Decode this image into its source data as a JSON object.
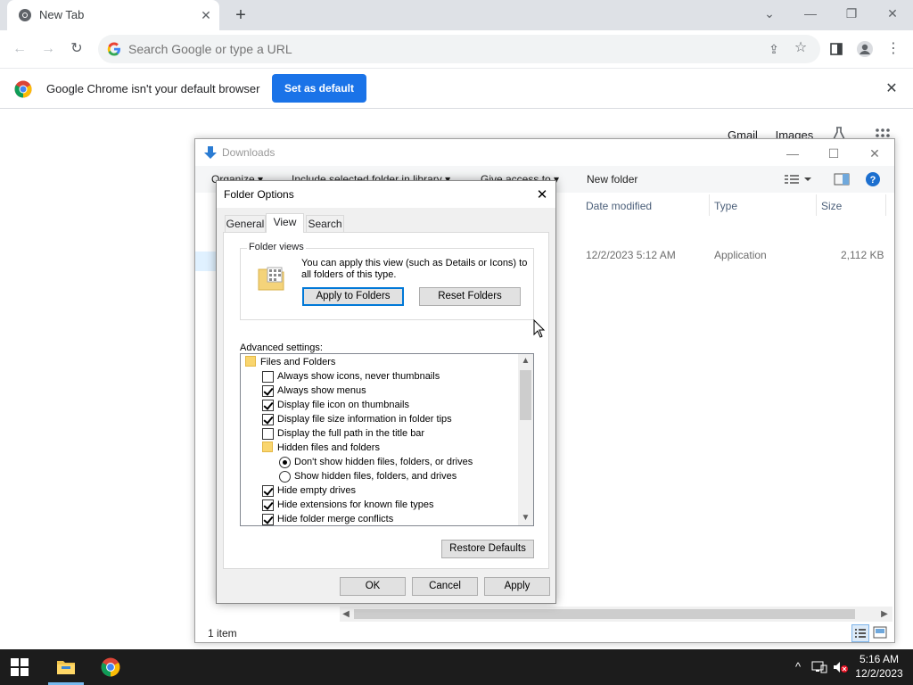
{
  "chrome": {
    "tab_title": "New Tab",
    "tab_close": "✕",
    "new_tab_label": "+",
    "omnibox_placeholder": "Search Google or type a URL",
    "infobar": {
      "message": "Google Chrome isn't your default browser",
      "button": "Set as default"
    },
    "ntp_links": [
      "Gmail",
      "Images"
    ]
  },
  "explorer": {
    "title": "Downloads",
    "commands": [
      "Organize ▾",
      "Include selected folder in library ▾",
      "Give access to ▾",
      "New folder"
    ],
    "columns": [
      "Date modified",
      "Type",
      "Size"
    ],
    "row": {
      "date": "12/2/2023 5:12 AM",
      "type": "Application",
      "size": "2,112 KB"
    },
    "status": "1 item"
  },
  "dialog": {
    "title": "Folder Options",
    "tabs": [
      "General",
      "View",
      "Search"
    ],
    "active_tab": "View",
    "folder_views": {
      "legend": "Folder views",
      "description": "You can apply this view (such as Details or Icons) to all folders of this type.",
      "apply_button": "Apply to Folders",
      "reset_button": "Reset Folders"
    },
    "advanced_label": "Advanced settings:",
    "advanced": [
      {
        "kind": "folder",
        "indent": 0,
        "label": "Files and Folders"
      },
      {
        "kind": "checkbox",
        "indent": 1,
        "checked": false,
        "label": "Always show icons, never thumbnails"
      },
      {
        "kind": "checkbox",
        "indent": 1,
        "checked": true,
        "label": "Always show menus"
      },
      {
        "kind": "checkbox",
        "indent": 1,
        "checked": true,
        "label": "Display file icon on thumbnails"
      },
      {
        "kind": "checkbox",
        "indent": 1,
        "checked": true,
        "label": "Display file size information in folder tips"
      },
      {
        "kind": "checkbox",
        "indent": 1,
        "checked": false,
        "label": "Display the full path in the title bar"
      },
      {
        "kind": "folder",
        "indent": 1,
        "label": "Hidden files and folders"
      },
      {
        "kind": "radio",
        "indent": 2,
        "checked": true,
        "label": "Don't show hidden files, folders, or drives"
      },
      {
        "kind": "radio",
        "indent": 2,
        "checked": false,
        "label": "Show hidden files, folders, and drives"
      },
      {
        "kind": "checkbox",
        "indent": 1,
        "checked": true,
        "label": "Hide empty drives"
      },
      {
        "kind": "checkbox",
        "indent": 1,
        "checked": true,
        "label": "Hide extensions for known file types"
      },
      {
        "kind": "checkbox",
        "indent": 1,
        "checked": true,
        "label": "Hide folder merge conflicts"
      }
    ],
    "restore_button": "Restore Defaults",
    "ok": "OK",
    "cancel": "Cancel",
    "apply": "Apply"
  },
  "taskbar": {
    "time": "5:16 AM",
    "date": "12/2/2023"
  },
  "colors": {
    "chrome_blue": "#1a73e8",
    "focus_blue": "#0078d7",
    "taskbar": "#1c1c1c"
  }
}
